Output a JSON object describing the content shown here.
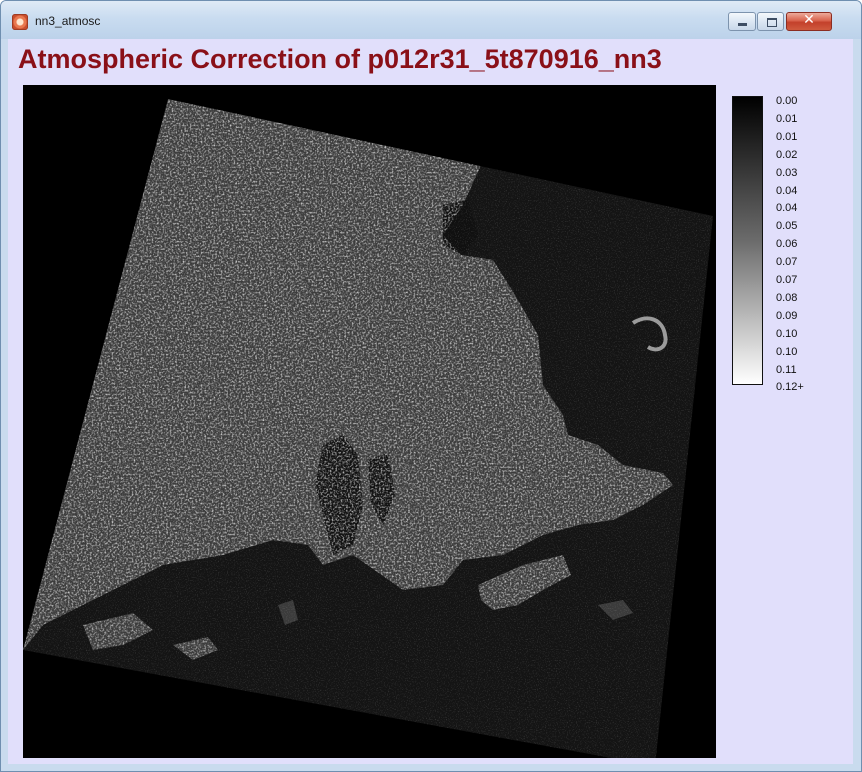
{
  "window": {
    "title": "nn3_atmosc",
    "close_glyph": "✕"
  },
  "heading": "Atmospheric Correction of p012r31_5t870916_nn3",
  "image": {
    "description_icon": "grayscale-satellite-scene",
    "background": "#000000"
  },
  "colorbar": {
    "labels": [
      "0.00",
      "0.01",
      "0.01",
      "0.02",
      "0.03",
      "0.04",
      "0.04",
      "0.05",
      "0.06",
      "0.07",
      "0.07",
      "0.08",
      "0.09",
      "0.10",
      "0.10",
      "0.11",
      "0.12+"
    ],
    "colors": {
      "low": "#000000",
      "high": "#ffffff"
    }
  },
  "colors": {
    "heading": "#8a1018",
    "panel_bg": "#e1dffb",
    "close_button": "#c3402b"
  }
}
